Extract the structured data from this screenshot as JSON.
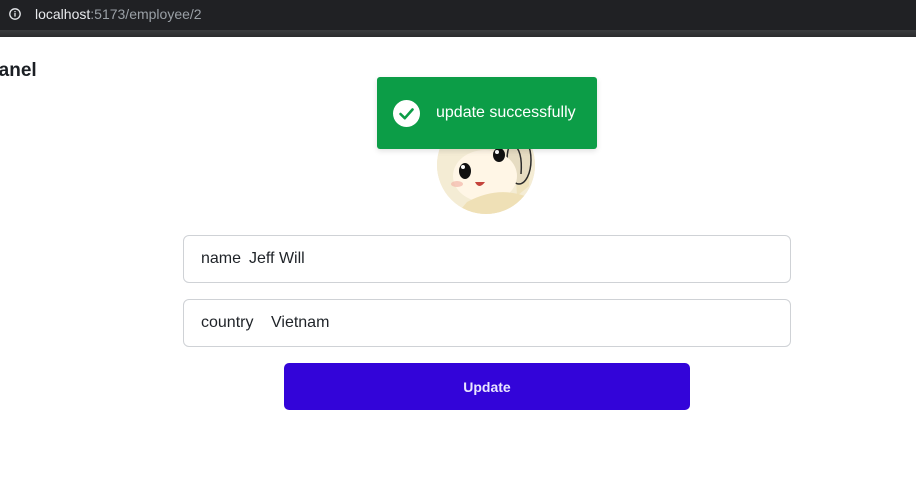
{
  "browser": {
    "url_host": "localhost",
    "url_path": ":5173/employee/2",
    "icon": "info-icon"
  },
  "page": {
    "heading": "Panel"
  },
  "toast": {
    "message": "update successfully",
    "icon": "check-circle-icon",
    "color": "#0c9d47"
  },
  "avatar": {
    "icon": "avatar-image"
  },
  "form": {
    "name": {
      "label": "name",
      "value": "Jeff Will"
    },
    "country": {
      "label": "country",
      "value": "Vietnam"
    },
    "submit_label": "Update",
    "accent": "#3304d9"
  }
}
